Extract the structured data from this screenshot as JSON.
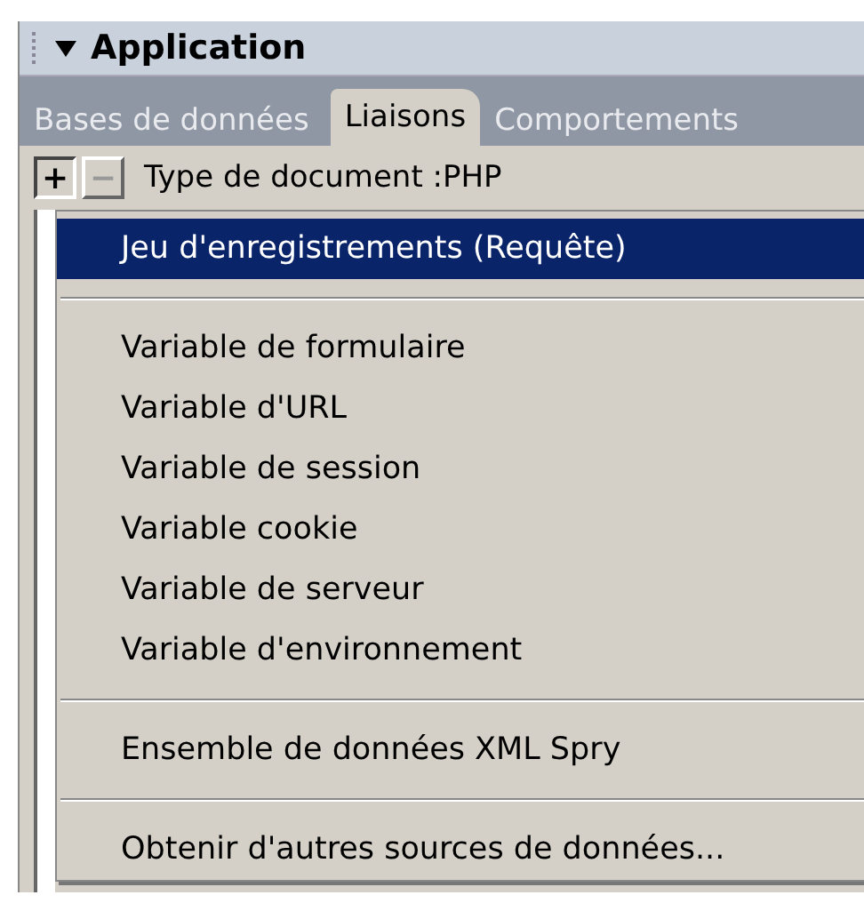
{
  "panel": {
    "title": "Application",
    "expanded": true
  },
  "tabs": [
    {
      "label": "Bases de données",
      "selected": false
    },
    {
      "label": "Liaisons",
      "selected": true
    },
    {
      "label": "Comportements",
      "selected": false
    }
  ],
  "toolbar": {
    "buttons": [
      {
        "symbol": "+",
        "disabled": false
      },
      {
        "symbol": "−",
        "disabled": true
      }
    ],
    "document_type": "Type de document :PHP"
  },
  "menu": [
    {
      "kind": "item",
      "label": "Jeu d'enregistrements (Requête)",
      "selected": true
    },
    {
      "kind": "separator"
    },
    {
      "kind": "item",
      "label": "Variable de formulaire",
      "selected": false
    },
    {
      "kind": "item",
      "label": "Variable d'URL",
      "selected": false
    },
    {
      "kind": "item",
      "label": "Variable de session",
      "selected": false
    },
    {
      "kind": "item",
      "label": "Variable cookie",
      "selected": false
    },
    {
      "kind": "item",
      "label": "Variable de serveur",
      "selected": false
    },
    {
      "kind": "item",
      "label": "Variable d'environnement",
      "selected": false
    },
    {
      "kind": "separator"
    },
    {
      "kind": "item",
      "label": "Ensemble de données XML Spry",
      "selected": false
    },
    {
      "kind": "separator"
    },
    {
      "kind": "item",
      "label": "Obtenir d'autres sources de données...",
      "selected": false
    }
  ]
}
